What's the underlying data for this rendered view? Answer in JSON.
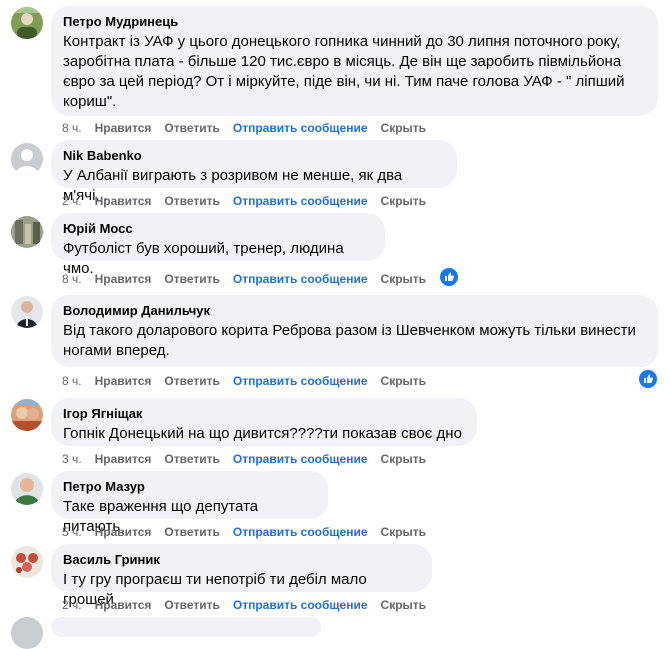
{
  "comments": [
    {
      "author": "Петро Мудринець",
      "text": "Контракт із УАФ у цього донецького гопника чинний до 30 липня поточного року, заробітна плата - більше 120 тис.євро в місяць. Де він ще заробить півмільйона євро за цей період? От і міркуйте, піде він, чи ні. Тим паче голова УАФ - \" ліпший кориш\".",
      "time": "8 ч.",
      "avatar_color": "#5d7a3a"
    },
    {
      "author": "Nik Babenko",
      "text": "У Албанії виграють з розривом не менше, як два м'ячі...",
      "time": "2 ч.",
      "avatar_color": "#c9ccd1"
    },
    {
      "author": "Юрій Мосс",
      "text": "Футболіст був хороший, тренер, людина чмо.",
      "time": "8 ч.",
      "avatar_color": "#8a8f7a",
      "reaction": "like"
    },
    {
      "author": "Володимир Данильчук",
      "text": "Від такого доларового корита Реброва разом із Шевченком можуть тільки винести ногами вперед.",
      "time": "8 ч.",
      "avatar_color": "#2a2f3a",
      "reaction": "like"
    },
    {
      "author": "Ігор Ягніщак",
      "text": "Гопнік Донецький на що дивится????ти показав своє дно",
      "time": "3 ч.",
      "avatar_color": "#c0643c"
    },
    {
      "author": "Петро Мазур",
      "text": "Таке враження що депутата питають",
      "time": "5 ч.",
      "avatar_color": "#4a7a4a"
    },
    {
      "author": "Василь Гриник",
      "text": "І ту гру програєш ти непотріб ти дебіл мало грошей",
      "time": "2 ч.",
      "avatar_color": "#d8d4cc"
    }
  ],
  "actions": {
    "like": "Нравится",
    "reply": "Ответить",
    "send_message": "Отправить сообщение",
    "hide": "Скрыть"
  },
  "colors": {
    "bubble": "#f0f2f5",
    "link": "#216fdb",
    "muted": "#65676b",
    "like_blue": "#1877f2"
  }
}
